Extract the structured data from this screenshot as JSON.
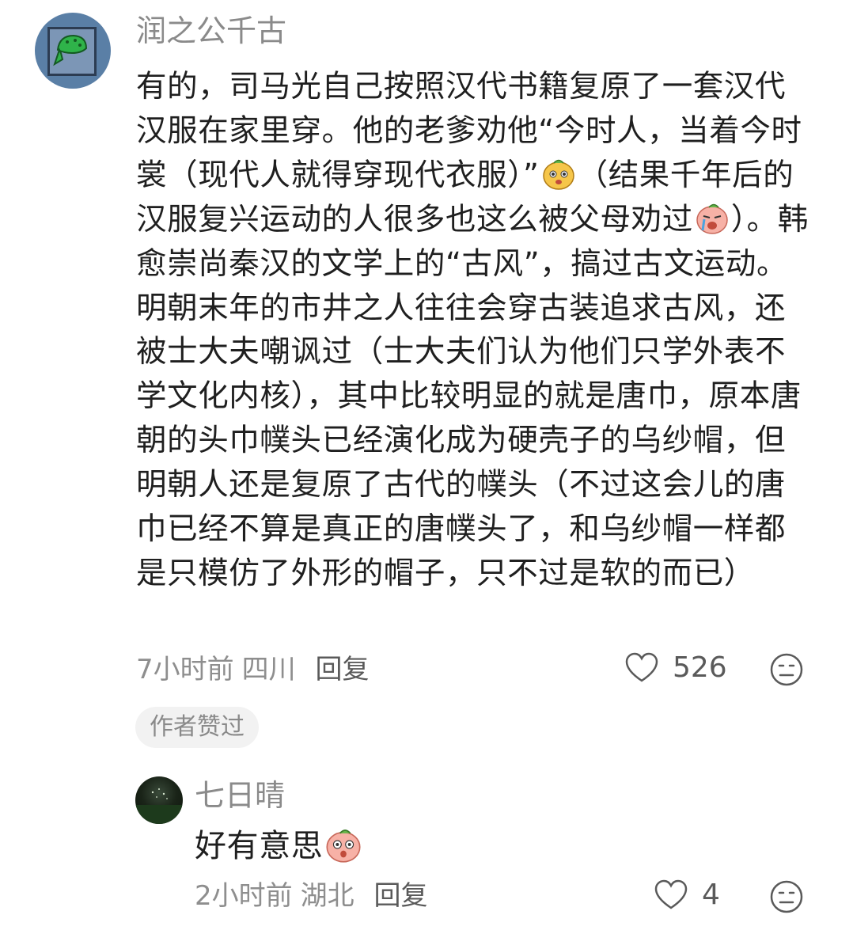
{
  "comment": {
    "username": "润之公千古",
    "avatar_icon": "green-bandana-avatar",
    "text_parts": [
      "有的，司马光自己按照汉代书籍复原了一套汉代汉服在家里穿。他的老爹劝他“今时人，当着今时裳（现代人就得穿现代衣服）”",
      "（结果千年后的汉服复兴运动的人很多也这么被父母劝过",
      "）。韩愈崇尚秦汉的文学上的“古风”，搞过古文运动。明朝末年的市井之人往往会穿古装追求古风，还被士大夫嘲讽过（士大夫们认为他们只学外表不学文化内核），其中比较明显的就是唐巾，原本唐朝的头巾幞头已经演化成为硬壳子的乌纱帽，但明朝人还是复原了古代的幞头（不过这会儿的唐巾已经不算是真正的唐幞头了，和乌纱帽一样都是只模仿了外形的帽子，只不过是软的而已）"
    ],
    "emoji_1": "cheeky-mole-emoji",
    "emoji_2": "crying-peach-emoji",
    "time": "7小时前",
    "location": "四川",
    "reply_label": "回复",
    "likes": "526",
    "author_liked_badge": "作者赞过"
  },
  "reply": {
    "username": "七日晴",
    "avatar_icon": "night-field-avatar",
    "text": "好有意思",
    "emoji": "surprised-peach-emoji",
    "time": "2小时前",
    "location": "湖北",
    "reply_label": "回复",
    "likes": "4"
  },
  "colors": {
    "text": "#1f1f1f",
    "muted": "#8a8a8a",
    "badge_bg": "#f2f2f2"
  }
}
